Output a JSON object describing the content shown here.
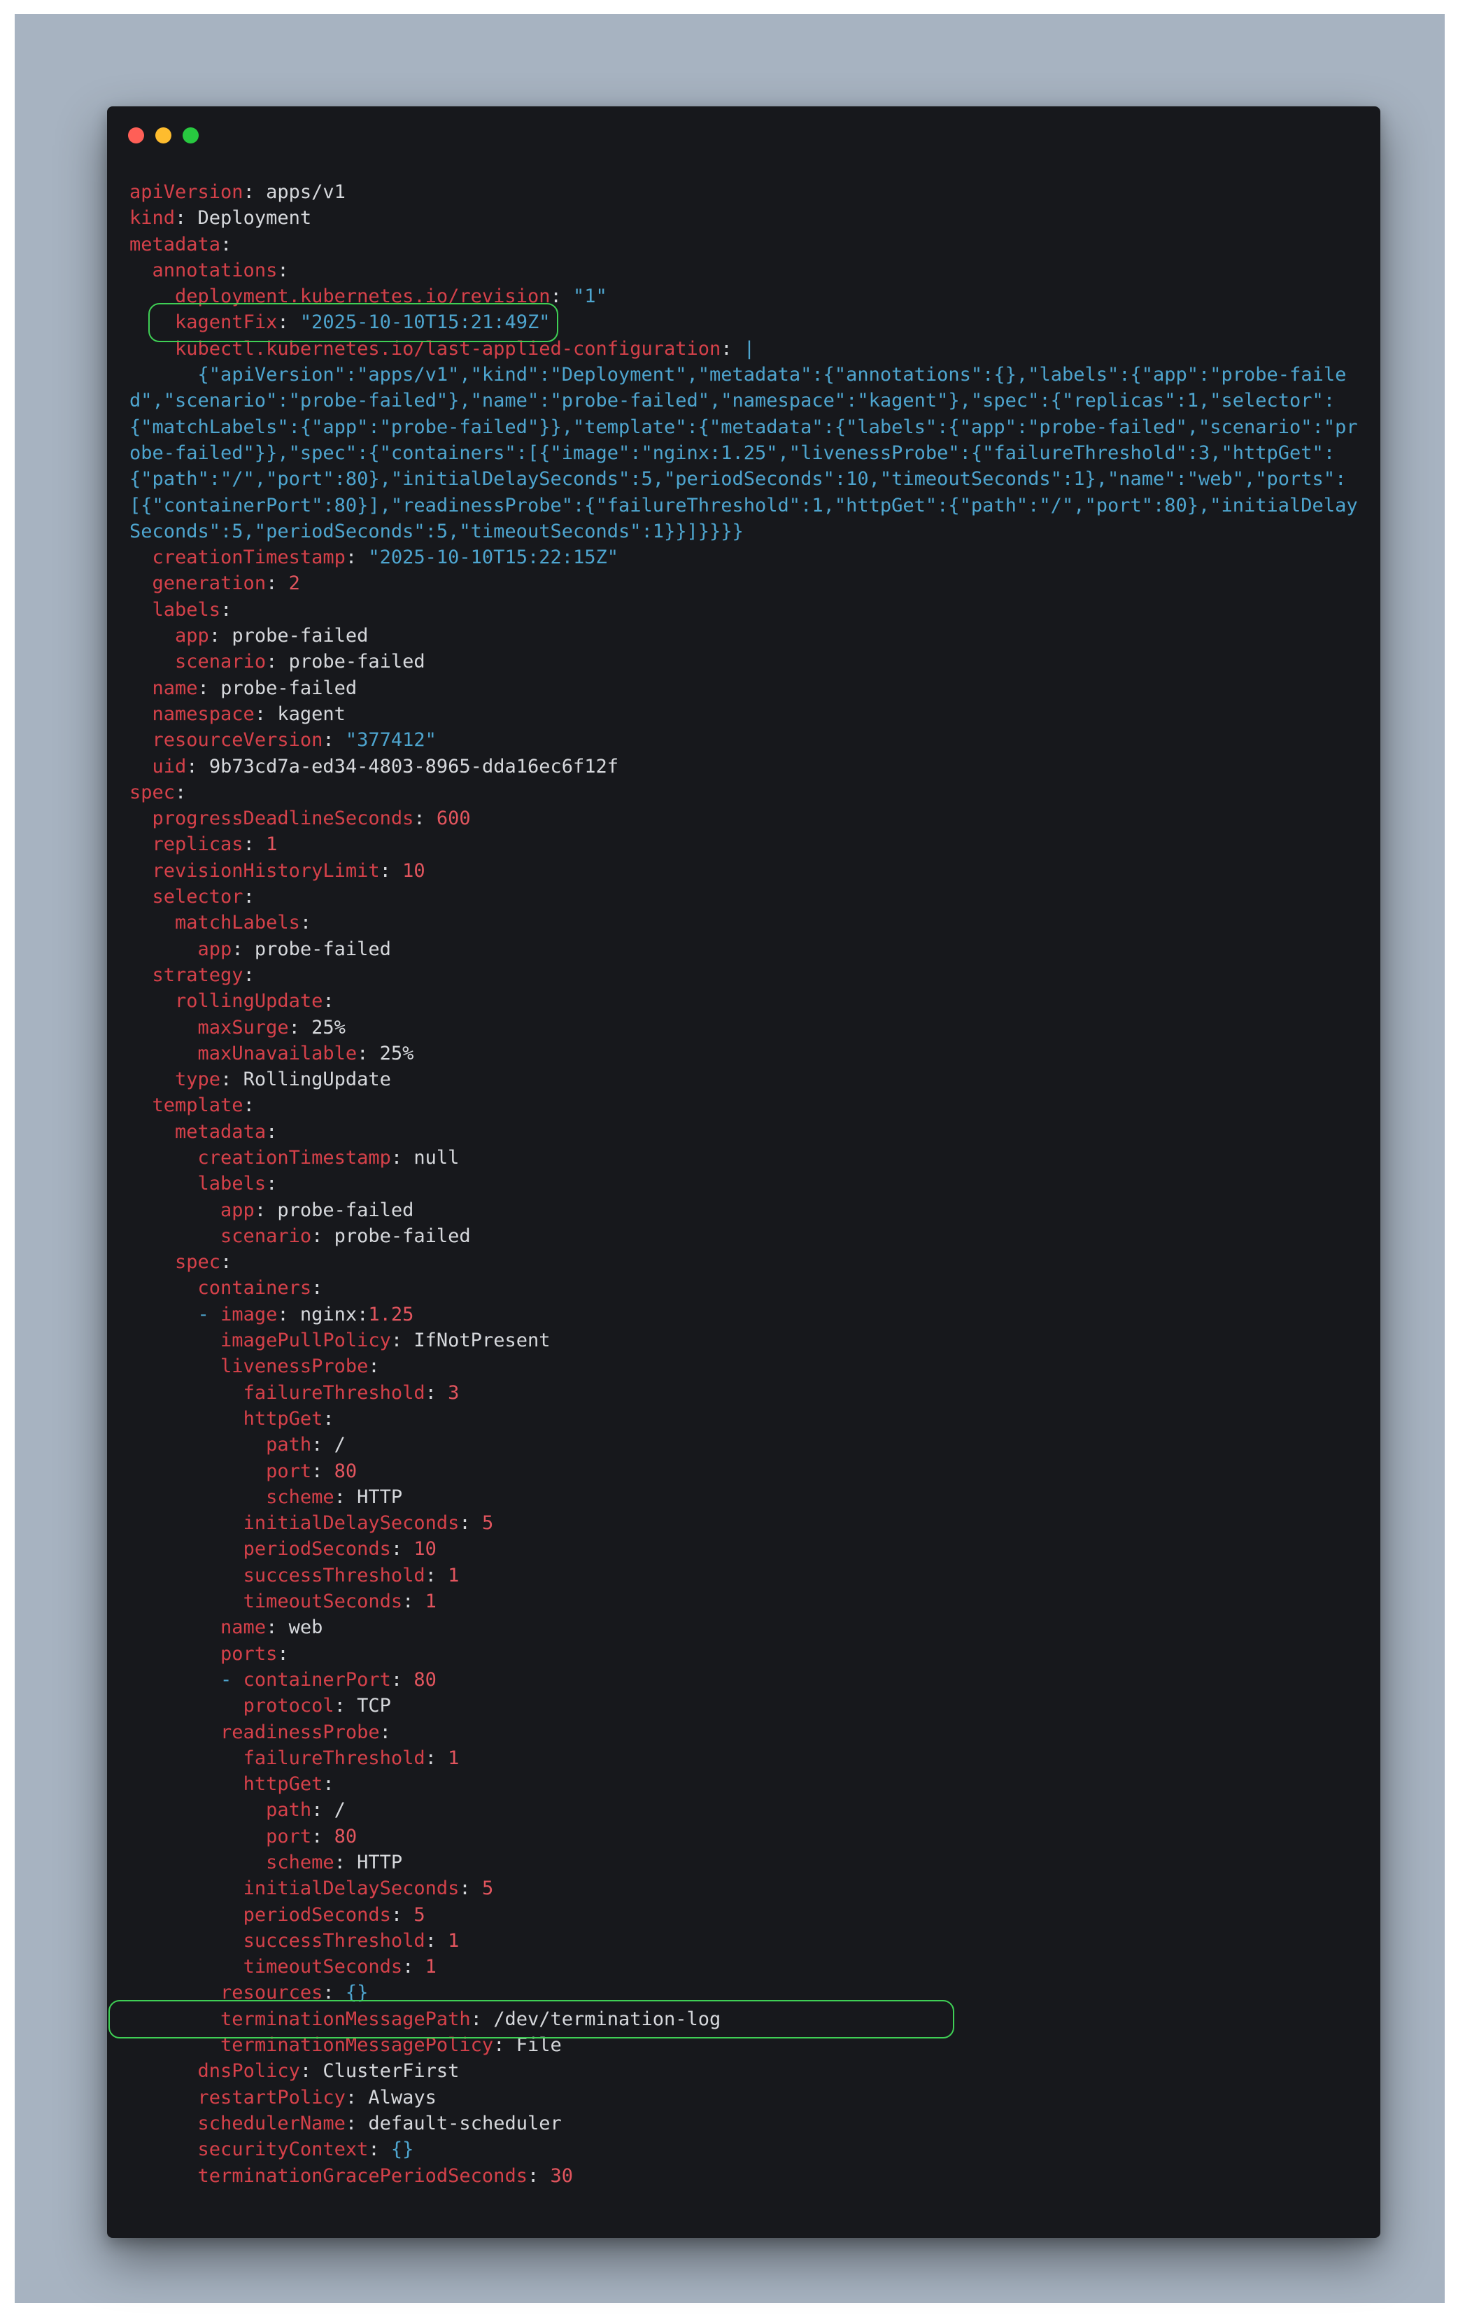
{
  "colors": {
    "backdrop": "#a7b3c1",
    "window_bg": "#17181c",
    "key": "#d5414a",
    "string": "#4ea5cf",
    "number": "#e2555e",
    "plain": "#d6d8dc",
    "highlight": "#3fcf55",
    "dot_close": "#ff5f57",
    "dot_minimize": "#febc2e",
    "dot_zoom": "#28c840"
  },
  "window_controls": [
    "close-icon",
    "minimize-icon",
    "zoom-icon"
  ],
  "highlighted_lines": [
    5,
    64
  ],
  "lines": [
    [
      [
        "k",
        "apiVersion"
      ],
      [
        "p",
        ": "
      ],
      [
        "v",
        "apps/v1"
      ]
    ],
    [
      [
        "k",
        "kind"
      ],
      [
        "p",
        ": "
      ],
      [
        "v",
        "Deployment"
      ]
    ],
    [
      [
        "k",
        "metadata"
      ],
      [
        "p",
        ":"
      ]
    ],
    [
      [
        "p",
        "  "
      ],
      [
        "k",
        "annotations"
      ],
      [
        "p",
        ":"
      ]
    ],
    [
      [
        "p",
        "    "
      ],
      [
        "k",
        "deployment.kubernetes.io/revision"
      ],
      [
        "p",
        ": "
      ],
      [
        "s",
        "\"1\""
      ]
    ],
    [
      [
        "p",
        "    "
      ],
      [
        "k",
        "kagentFix"
      ],
      [
        "p",
        ": "
      ],
      [
        "s",
        "\"2025-10-10T15:21:49Z\""
      ]
    ],
    [
      [
        "p",
        "    "
      ],
      [
        "k",
        "kubectl.kubernetes.io/last-applied-configuration"
      ],
      [
        "p",
        ": "
      ],
      [
        "s",
        "|"
      ]
    ],
    {
      "wrap": true,
      "segments": [
        [
          "s",
          "      {\"apiVersion\":\"apps/v1\",\"kind\":\"Deployment\",\"metadata\":{\"annotations\":{},\"labels\":{\"app\":\"probe-failed\",\"scenario\":\"probe-failed\"},\"name\":\"probe-failed\",\"namespace\":\"kagent\"},\"spec\":{\"replicas\":1,\"selector\":{\"matchLabels\":{\"app\":\"probe-failed\"}},\"template\":{\"metadata\":{\"labels\":{\"app\":\"probe-failed\",\"scenario\":\"probe-failed\"}},\"spec\":{\"containers\":[{\"image\":\"nginx:1.25\",\"livenessProbe\":{\"failureThreshold\":3,\"httpGet\":{\"path\":\"/\",\"port\":80},\"initialDelaySeconds\":5,\"periodSeconds\":10,\"timeoutSeconds\":1},\"name\":\"web\",\"ports\":[{\"containerPort\":80}],\"readinessProbe\":{\"failureThreshold\":1,\"httpGet\":{\"path\":\"/\",\"port\":80},\"initialDelaySeconds\":5,\"periodSeconds\":5,\"timeoutSeconds\":1}}]}}}}"
        ]
      ]
    },
    [
      [
        "p",
        "  "
      ],
      [
        "k",
        "creationTimestamp"
      ],
      [
        "p",
        ": "
      ],
      [
        "s",
        "\"2025-10-10T15:22:15Z\""
      ]
    ],
    [
      [
        "p",
        "  "
      ],
      [
        "k",
        "generation"
      ],
      [
        "p",
        ": "
      ],
      [
        "n",
        "2"
      ]
    ],
    [
      [
        "p",
        "  "
      ],
      [
        "k",
        "labels"
      ],
      [
        "p",
        ":"
      ]
    ],
    [
      [
        "p",
        "    "
      ],
      [
        "k",
        "app"
      ],
      [
        "p",
        ": "
      ],
      [
        "v",
        "probe-failed"
      ]
    ],
    [
      [
        "p",
        "    "
      ],
      [
        "k",
        "scenario"
      ],
      [
        "p",
        ": "
      ],
      [
        "v",
        "probe-failed"
      ]
    ],
    [
      [
        "p",
        "  "
      ],
      [
        "k",
        "name"
      ],
      [
        "p",
        ": "
      ],
      [
        "v",
        "probe-failed"
      ]
    ],
    [
      [
        "p",
        "  "
      ],
      [
        "k",
        "namespace"
      ],
      [
        "p",
        ": "
      ],
      [
        "v",
        "kagent"
      ]
    ],
    [
      [
        "p",
        "  "
      ],
      [
        "k",
        "resourceVersion"
      ],
      [
        "p",
        ": "
      ],
      [
        "s",
        "\"377412\""
      ]
    ],
    [
      [
        "p",
        "  "
      ],
      [
        "k",
        "uid"
      ],
      [
        "p",
        ": "
      ],
      [
        "v",
        "9b73cd7a-ed34-4803-8965-dda16ec6f12f"
      ]
    ],
    [
      [
        "k",
        "spec"
      ],
      [
        "p",
        ":"
      ]
    ],
    [
      [
        "p",
        "  "
      ],
      [
        "k",
        "progressDeadlineSeconds"
      ],
      [
        "p",
        ": "
      ],
      [
        "n",
        "600"
      ]
    ],
    [
      [
        "p",
        "  "
      ],
      [
        "k",
        "replicas"
      ],
      [
        "p",
        ": "
      ],
      [
        "n",
        "1"
      ]
    ],
    [
      [
        "p",
        "  "
      ],
      [
        "k",
        "revisionHistoryLimit"
      ],
      [
        "p",
        ": "
      ],
      [
        "n",
        "10"
      ]
    ],
    [
      [
        "p",
        "  "
      ],
      [
        "k",
        "selector"
      ],
      [
        "p",
        ":"
      ]
    ],
    [
      [
        "p",
        "    "
      ],
      [
        "k",
        "matchLabels"
      ],
      [
        "p",
        ":"
      ]
    ],
    [
      [
        "p",
        "      "
      ],
      [
        "k",
        "app"
      ],
      [
        "p",
        ": "
      ],
      [
        "v",
        "probe-failed"
      ]
    ],
    [
      [
        "p",
        "  "
      ],
      [
        "k",
        "strategy"
      ],
      [
        "p",
        ":"
      ]
    ],
    [
      [
        "p",
        "    "
      ],
      [
        "k",
        "rollingUpdate"
      ],
      [
        "p",
        ":"
      ]
    ],
    [
      [
        "p",
        "      "
      ],
      [
        "k",
        "maxSurge"
      ],
      [
        "p",
        ": "
      ],
      [
        "v",
        "25%"
      ]
    ],
    [
      [
        "p",
        "      "
      ],
      [
        "k",
        "maxUnavailable"
      ],
      [
        "p",
        ": "
      ],
      [
        "v",
        "25%"
      ]
    ],
    [
      [
        "p",
        "    "
      ],
      [
        "k",
        "type"
      ],
      [
        "p",
        ": "
      ],
      [
        "v",
        "RollingUpdate"
      ]
    ],
    [
      [
        "p",
        "  "
      ],
      [
        "k",
        "template"
      ],
      [
        "p",
        ":"
      ]
    ],
    [
      [
        "p",
        "    "
      ],
      [
        "k",
        "metadata"
      ],
      [
        "p",
        ":"
      ]
    ],
    [
      [
        "p",
        "      "
      ],
      [
        "k",
        "creationTimestamp"
      ],
      [
        "p",
        ": "
      ],
      [
        "v",
        "null"
      ]
    ],
    [
      [
        "p",
        "      "
      ],
      [
        "k",
        "labels"
      ],
      [
        "p",
        ":"
      ]
    ],
    [
      [
        "p",
        "        "
      ],
      [
        "k",
        "app"
      ],
      [
        "p",
        ": "
      ],
      [
        "v",
        "probe-failed"
      ]
    ],
    [
      [
        "p",
        "        "
      ],
      [
        "k",
        "scenario"
      ],
      [
        "p",
        ": "
      ],
      [
        "v",
        "probe-failed"
      ]
    ],
    [
      [
        "p",
        "    "
      ],
      [
        "k",
        "spec"
      ],
      [
        "p",
        ":"
      ]
    ],
    [
      [
        "p",
        "      "
      ],
      [
        "k",
        "containers"
      ],
      [
        "p",
        ":"
      ]
    ],
    [
      [
        "p",
        "      "
      ],
      [
        "b",
        "- "
      ],
      [
        "k",
        "image"
      ],
      [
        "p",
        ": "
      ],
      [
        "v",
        "nginx:"
      ],
      [
        "n",
        "1.25"
      ]
    ],
    [
      [
        "p",
        "        "
      ],
      [
        "k",
        "imagePullPolicy"
      ],
      [
        "p",
        ": "
      ],
      [
        "v",
        "IfNotPresent"
      ]
    ],
    [
      [
        "p",
        "        "
      ],
      [
        "k",
        "livenessProbe"
      ],
      [
        "p",
        ":"
      ]
    ],
    [
      [
        "p",
        "          "
      ],
      [
        "k",
        "failureThreshold"
      ],
      [
        "p",
        ": "
      ],
      [
        "n",
        "3"
      ]
    ],
    [
      [
        "p",
        "          "
      ],
      [
        "k",
        "httpGet"
      ],
      [
        "p",
        ":"
      ]
    ],
    [
      [
        "p",
        "            "
      ],
      [
        "k",
        "path"
      ],
      [
        "p",
        ": "
      ],
      [
        "v",
        "/"
      ]
    ],
    [
      [
        "p",
        "            "
      ],
      [
        "k",
        "port"
      ],
      [
        "p",
        ": "
      ],
      [
        "n",
        "80"
      ]
    ],
    [
      [
        "p",
        "            "
      ],
      [
        "k",
        "scheme"
      ],
      [
        "p",
        ": "
      ],
      [
        "v",
        "HTTP"
      ]
    ],
    [
      [
        "p",
        "          "
      ],
      [
        "k",
        "initialDelaySeconds"
      ],
      [
        "p",
        ": "
      ],
      [
        "n",
        "5"
      ]
    ],
    [
      [
        "p",
        "          "
      ],
      [
        "k",
        "periodSeconds"
      ],
      [
        "p",
        ": "
      ],
      [
        "n",
        "10"
      ]
    ],
    [
      [
        "p",
        "          "
      ],
      [
        "k",
        "successThreshold"
      ],
      [
        "p",
        ": "
      ],
      [
        "n",
        "1"
      ]
    ],
    [
      [
        "p",
        "          "
      ],
      [
        "k",
        "timeoutSeconds"
      ],
      [
        "p",
        ": "
      ],
      [
        "n",
        "1"
      ]
    ],
    [
      [
        "p",
        "        "
      ],
      [
        "k",
        "name"
      ],
      [
        "p",
        ": "
      ],
      [
        "v",
        "web"
      ]
    ],
    [
      [
        "p",
        "        "
      ],
      [
        "k",
        "ports"
      ],
      [
        "p",
        ":"
      ]
    ],
    [
      [
        "p",
        "        "
      ],
      [
        "b",
        "- "
      ],
      [
        "k",
        "containerPort"
      ],
      [
        "p",
        ": "
      ],
      [
        "n",
        "80"
      ]
    ],
    [
      [
        "p",
        "          "
      ],
      [
        "k",
        "protocol"
      ],
      [
        "p",
        ": "
      ],
      [
        "v",
        "TCP"
      ]
    ],
    [
      [
        "p",
        "        "
      ],
      [
        "k",
        "readinessProbe"
      ],
      [
        "p",
        ":"
      ]
    ],
    [
      [
        "p",
        "          "
      ],
      [
        "k",
        "failureThreshold"
      ],
      [
        "p",
        ": "
      ],
      [
        "n",
        "1"
      ]
    ],
    [
      [
        "p",
        "          "
      ],
      [
        "k",
        "httpGet"
      ],
      [
        "p",
        ":"
      ]
    ],
    [
      [
        "p",
        "            "
      ],
      [
        "k",
        "path"
      ],
      [
        "p",
        ": "
      ],
      [
        "v",
        "/"
      ]
    ],
    [
      [
        "p",
        "            "
      ],
      [
        "k",
        "port"
      ],
      [
        "p",
        ": "
      ],
      [
        "n",
        "80"
      ]
    ],
    [
      [
        "p",
        "            "
      ],
      [
        "k",
        "scheme"
      ],
      [
        "p",
        ": "
      ],
      [
        "v",
        "HTTP"
      ]
    ],
    [
      [
        "p",
        "          "
      ],
      [
        "k",
        "initialDelaySeconds"
      ],
      [
        "p",
        ": "
      ],
      [
        "n",
        "5"
      ]
    ],
    [
      [
        "p",
        "          "
      ],
      [
        "k",
        "periodSeconds"
      ],
      [
        "p",
        ": "
      ],
      [
        "n",
        "5"
      ]
    ],
    [
      [
        "p",
        "          "
      ],
      [
        "k",
        "successThreshold"
      ],
      [
        "p",
        ": "
      ],
      [
        "n",
        "1"
      ]
    ],
    [
      [
        "p",
        "          "
      ],
      [
        "k",
        "timeoutSeconds"
      ],
      [
        "p",
        ": "
      ],
      [
        "n",
        "1"
      ]
    ],
    [
      [
        "p",
        "        "
      ],
      [
        "k",
        "resources"
      ],
      [
        "p",
        ": "
      ],
      [
        "s",
        "{}"
      ]
    ],
    [
      [
        "p",
        "        "
      ],
      [
        "k",
        "terminationMessagePath"
      ],
      [
        "p",
        ": "
      ],
      [
        "v",
        "/dev/termination-log"
      ]
    ],
    [
      [
        "p",
        "        "
      ],
      [
        "k",
        "terminationMessagePolicy"
      ],
      [
        "p",
        ": "
      ],
      [
        "v",
        "File"
      ]
    ],
    [
      [
        "p",
        "      "
      ],
      [
        "k",
        "dnsPolicy"
      ],
      [
        "p",
        ": "
      ],
      [
        "v",
        "ClusterFirst"
      ]
    ],
    [
      [
        "p",
        "      "
      ],
      [
        "k",
        "restartPolicy"
      ],
      [
        "p",
        ": "
      ],
      [
        "v",
        "Always"
      ]
    ],
    [
      [
        "p",
        "      "
      ],
      [
        "k",
        "schedulerName"
      ],
      [
        "p",
        ": "
      ],
      [
        "v",
        "default-scheduler"
      ]
    ],
    [
      [
        "p",
        "      "
      ],
      [
        "k",
        "securityContext"
      ],
      [
        "p",
        ": "
      ],
      [
        "s",
        "{}"
      ]
    ],
    [
      [
        "p",
        "      "
      ],
      [
        "k",
        "terminationGracePeriodSeconds"
      ],
      [
        "p",
        ": "
      ],
      [
        "n",
        "30"
      ]
    ]
  ]
}
